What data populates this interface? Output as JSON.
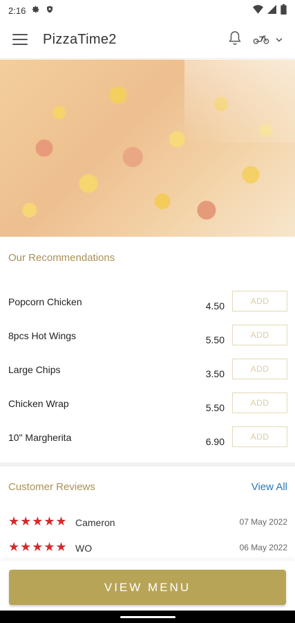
{
  "status_bar": {
    "time": "2:16"
  },
  "app_bar": {
    "title": "PizzaTime2"
  },
  "recommendations": {
    "title": "Our Recommendations",
    "items": [
      {
        "name": "Popcorn Chicken",
        "price": "4.50",
        "action": "ADD"
      },
      {
        "name": "8pcs Hot Wings",
        "price": "5.50",
        "action": "ADD"
      },
      {
        "name": "Large Chips",
        "price": "3.50",
        "action": "ADD"
      },
      {
        "name": "Chicken Wrap",
        "price": "5.50",
        "action": "ADD"
      },
      {
        "name": "10\" Margherita",
        "price": "6.90",
        "action": "ADD"
      }
    ]
  },
  "reviews": {
    "title": "Customer Reviews",
    "view_all": "View All",
    "items": [
      {
        "stars": "★★★★★",
        "rating": 5,
        "name": "Cameron",
        "date": "07 May 2022"
      },
      {
        "stars": "★★★★★",
        "rating": 5,
        "name": "WO",
        "date": "06 May 2022"
      }
    ]
  },
  "cta": {
    "label": "VIEW MENU"
  },
  "icons": {
    "menu": "hamburger-menu-icon",
    "notifications": "bell-icon",
    "delivery": "scooter-icon",
    "dropdown": "chevron-down-icon"
  },
  "colors": {
    "accent_gold": "#b7a457",
    "section_title": "#a89158",
    "link_blue": "#2a7ab3",
    "star_red": "#d52b2b"
  }
}
